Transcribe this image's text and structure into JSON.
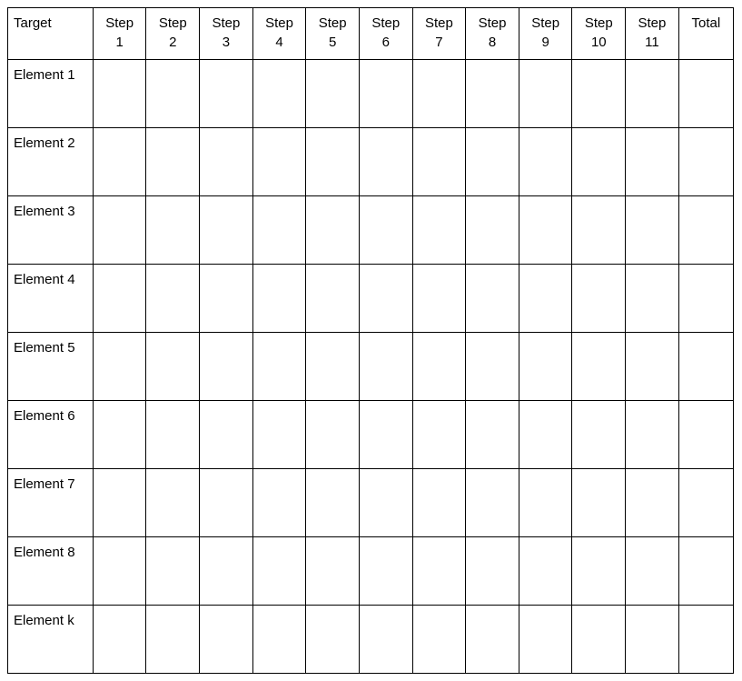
{
  "table": {
    "header": {
      "target": "Target",
      "step_word": "Step",
      "step_numbers": [
        "1",
        "2",
        "3",
        "4",
        "5",
        "6",
        "7",
        "8",
        "9",
        "10",
        "11"
      ],
      "total": "Total"
    },
    "rows": [
      {
        "label": "Element 1"
      },
      {
        "label": "Element 2"
      },
      {
        "label": "Element 3"
      },
      {
        "label": "Element 4"
      },
      {
        "label": "Element 5"
      },
      {
        "label": "Element 6"
      },
      {
        "label": "Element 7"
      },
      {
        "label": "Element 8"
      },
      {
        "label": "Element k"
      }
    ]
  }
}
